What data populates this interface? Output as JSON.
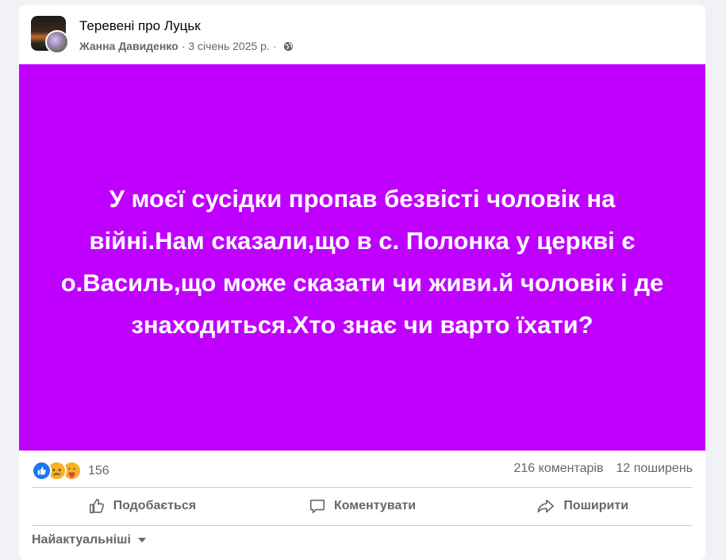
{
  "header": {
    "group_name": "Теревені про Луцьк",
    "author": "Жанна Давиденко",
    "separator": "·",
    "date": "3 січень 2025 р.",
    "privacy_separator": "·",
    "privacy_icon": "globe-icon"
  },
  "post": {
    "text": "У моєї сусідки пропав безвісті чоловік на війні.Нам сказали,що в с. Полонка у церкві є о.Василь,що може сказати чи живи.й чоловік і де знаходиться.Хто знає чи варто їхати?",
    "background_color": "#c000ff",
    "text_color": "#ffffff"
  },
  "stats": {
    "reaction_icons": [
      "like-icon",
      "sad-icon",
      "care-icon"
    ],
    "reaction_count": "156",
    "comments": "216 коментарів",
    "shares": "12 поширень"
  },
  "actions": {
    "like": "Подобається",
    "comment": "Коментувати",
    "share": "Поширити"
  },
  "comments_sort": {
    "label": "Найактуальніші"
  },
  "colors": {
    "accent": "#1877f2",
    "secondary_text": "#65676b",
    "page_bg": "#f0f2f5"
  }
}
